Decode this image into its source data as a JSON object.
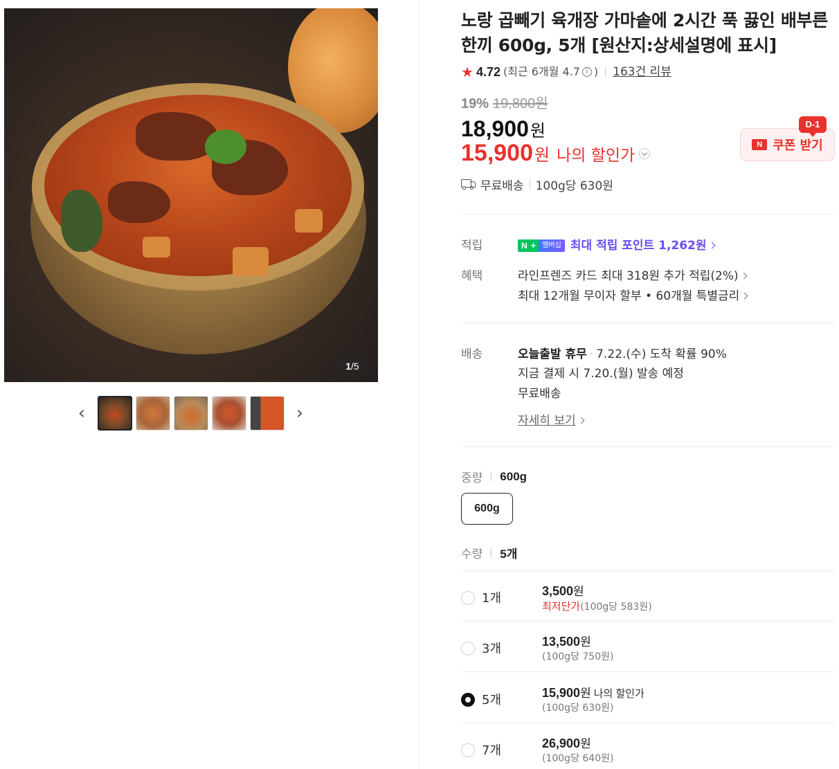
{
  "gallery": {
    "counter_current": "1",
    "counter_total": "/5",
    "prev_arrow": "‹",
    "next_arrow": "›"
  },
  "product": {
    "title": "노랑 곱빼기 육개장 가마솥에 2시간 푹 끓인 배부른 한끼 600g, 5개 [원산지:상세설명에 표시]",
    "rating": "4.72",
    "rating_recent": "(최근 6개월 4.7",
    "rating_recent_end": ")",
    "review_count": "163건 리뷰",
    "discount_rate": "19%",
    "original_price": "19,800원",
    "price": "18,900",
    "price_unit": "원",
    "my_price": "15,900",
    "my_price_unit": "원",
    "my_price_label": "나의 할인가",
    "shipping": "무료배송",
    "unit_price": "100g당 630원"
  },
  "coupon": {
    "badge": "D-1",
    "n_mark": "N",
    "label": "쿠폰 받기"
  },
  "benefits": {
    "point_label": "적립",
    "np_n": "N",
    "np_plus": "+",
    "np_member": "멤버십",
    "point_text": "최대 적립 포인트 1,262원",
    "benefit_label": "혜택",
    "card_benefit": "라인프렌즈 카드 최대 318원 추가 적립(2%)",
    "installment": "최대 12개월 무이자 할부 • 60개월 특별금리"
  },
  "delivery": {
    "label": "배송",
    "today": "오늘출발 휴무",
    "dot": "·",
    "arrival": "7.22.(수) 도착 확률 90%",
    "dispatch": "지금 결제 시 7.20.(월) 발송 예정",
    "fee": "무료배송",
    "detail_link": "자세히 보기"
  },
  "options": {
    "weight_label": "중량",
    "weight_selected": "600g",
    "weight_chip": "600g",
    "qty_label": "수량",
    "qty_selected": "5개",
    "quantities": [
      {
        "count": "1개",
        "price": "3,500",
        "unit": "원",
        "sub_highlight": "최저단가",
        "sub": "(100g당 583원)",
        "checked": false
      },
      {
        "count": "3개",
        "price": "13,500",
        "unit": "원",
        "sub_highlight": "",
        "sub": "(100g당 750원)",
        "checked": false
      },
      {
        "count": "5개",
        "price": "15,900",
        "unit": "원",
        "my_label": "나의 할인가",
        "sub_highlight": "",
        "sub": "(100g당 630원)",
        "checked": true
      },
      {
        "count": "7개",
        "price": "26,900",
        "unit": "원",
        "sub_highlight": "",
        "sub": "(100g당 640원)",
        "checked": false
      }
    ]
  },
  "colors": {
    "accent_red": "#e8322d",
    "naver_green": "#03c75a",
    "point_purple": "#6a4df0"
  }
}
